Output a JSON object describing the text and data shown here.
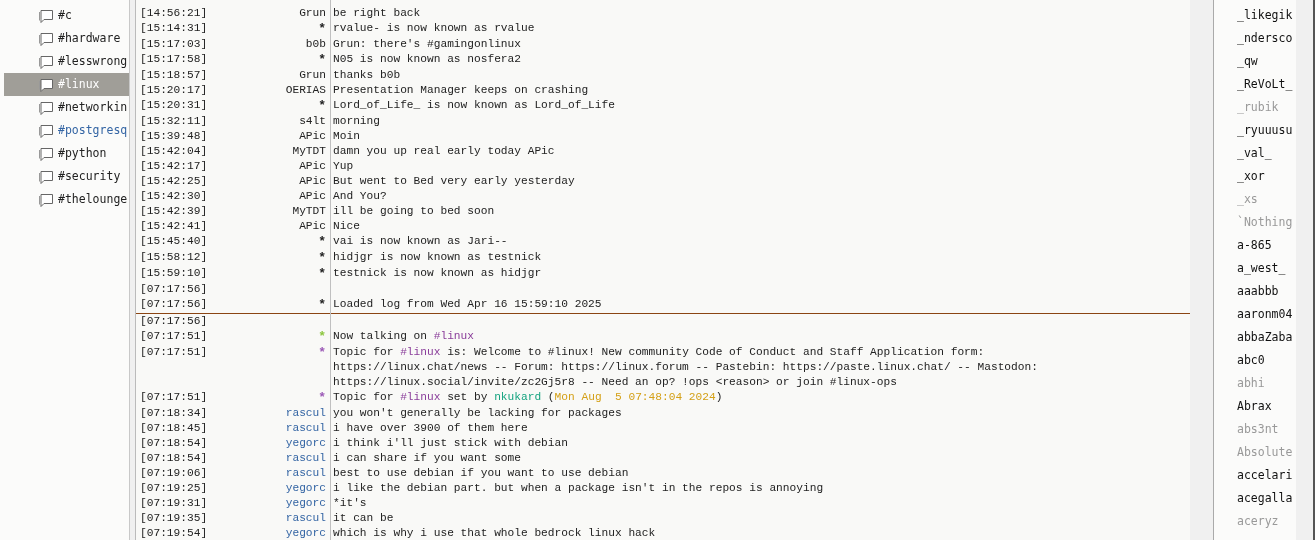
{
  "channels": [
    {
      "name": "#c",
      "selected": false,
      "unread": false
    },
    {
      "name": "#hardware",
      "selected": false,
      "unread": false
    },
    {
      "name": "#lesswrong",
      "selected": false,
      "unread": false
    },
    {
      "name": "#linux",
      "selected": true,
      "unread": false
    },
    {
      "name": "#networkin",
      "selected": false,
      "unread": false
    },
    {
      "name": "#postgresq",
      "selected": false,
      "unread": true
    },
    {
      "name": "#python",
      "selected": false,
      "unread": false
    },
    {
      "name": "#security",
      "selected": false,
      "unread": false
    },
    {
      "name": "#thelounge",
      "selected": false,
      "unread": false
    }
  ],
  "messages": [
    {
      "time": "[14:56:21]",
      "nick": "Grun",
      "parts": [
        {
          "kind": "plain",
          "text": "be right back"
        }
      ]
    },
    {
      "time": "[15:14:31]",
      "nick": "*",
      "parts": [
        {
          "kind": "plain",
          "text": "rvalue- is now known as rvalue"
        }
      ]
    },
    {
      "time": "[15:17:03]",
      "nick": "b0b",
      "parts": [
        {
          "kind": "plain",
          "text": "Grun: there's #gamingonlinux"
        }
      ]
    },
    {
      "time": "[15:17:58]",
      "nick": "*",
      "parts": [
        {
          "kind": "plain",
          "text": "N05 is now known as nosfera2"
        }
      ]
    },
    {
      "time": "[15:18:57]",
      "nick": "Grun",
      "parts": [
        {
          "kind": "plain",
          "text": "thanks b0b"
        }
      ]
    },
    {
      "time": "[15:20:17]",
      "nick": "OERIAS",
      "parts": [
        {
          "kind": "plain",
          "text": "Presentation Manager keeps on crashing"
        }
      ]
    },
    {
      "time": "[15:20:31]",
      "nick": "*",
      "parts": [
        {
          "kind": "plain",
          "text": "Lord_of_Life_ is now known as Lord_of_Life"
        }
      ]
    },
    {
      "time": "[15:32:11]",
      "nick": "s4lt",
      "parts": [
        {
          "kind": "plain",
          "text": "morning"
        }
      ]
    },
    {
      "time": "[15:39:48]",
      "nick": "APic",
      "parts": [
        {
          "kind": "plain",
          "text": "Moin"
        }
      ]
    },
    {
      "time": "[15:42:04]",
      "nick": "MyTDT",
      "parts": [
        {
          "kind": "plain",
          "text": "damn you up real early today APic"
        }
      ]
    },
    {
      "time": "[15:42:17]",
      "nick": "APic",
      "parts": [
        {
          "kind": "plain",
          "text": "Yup"
        }
      ]
    },
    {
      "time": "[15:42:25]",
      "nick": "APic",
      "parts": [
        {
          "kind": "plain",
          "text": "But went to Bed very early yesterday"
        }
      ]
    },
    {
      "time": "[15:42:30]",
      "nick": "APic",
      "parts": [
        {
          "kind": "plain",
          "text": "And You?"
        }
      ]
    },
    {
      "time": "[15:42:39]",
      "nick": "MyTDT",
      "parts": [
        {
          "kind": "plain",
          "text": "ill be going to bed soon"
        }
      ]
    },
    {
      "time": "[15:42:41]",
      "nick": "APic",
      "parts": [
        {
          "kind": "plain",
          "text": "Nice"
        }
      ]
    },
    {
      "time": "[15:45:40]",
      "nick": "*",
      "parts": [
        {
          "kind": "plain",
          "text": "vai is now known as Jari--"
        }
      ]
    },
    {
      "time": "[15:58:12]",
      "nick": "*",
      "parts": [
        {
          "kind": "plain",
          "text": "hidjgr is now known as testnick"
        }
      ]
    },
    {
      "time": "[15:59:10]",
      "nick": "*",
      "parts": [
        {
          "kind": "plain",
          "text": "testnick is now known as hidjgr"
        }
      ]
    },
    {
      "time": "[07:17:56]"
    },
    {
      "time": "[07:17:56]",
      "nick": "*",
      "marker_below": true,
      "parts": [
        {
          "kind": "plain",
          "text": "Loaded log from Wed Apr 16 15:59:10 2025"
        }
      ]
    },
    {
      "time": "[07:17:56]"
    },
    {
      "time": "[07:17:51]",
      "nick": "*",
      "color": "#8cc63f",
      "parts": [
        {
          "kind": "plain",
          "text": "Now talking on "
        },
        {
          "kind": "channel",
          "text": "#linux"
        }
      ]
    },
    {
      "time": "[07:17:51]",
      "nick": "*",
      "color": "#9b59b6",
      "parts": [
        {
          "kind": "plain",
          "text": "Topic for "
        },
        {
          "kind": "channel",
          "text": "#linux"
        },
        {
          "kind": "plain",
          "text": " is: Welcome to #linux! New community Code of Conduct and Staff Application form:\nhttps://linux.chat/news -- Forum: https://linux.forum -- Pastebin: https://paste.linux.chat/ -- Mastodon:\nhttps://linux.social/invite/zc2Gj5r8 -- Need an op? !ops <reason> or join #linux-ops"
        }
      ]
    },
    {
      "time": "[07:17:51]",
      "nick": "*",
      "color": "#9b59b6",
      "parts": [
        {
          "kind": "plain",
          "text": "Topic for "
        },
        {
          "kind": "channel",
          "text": "#linux"
        },
        {
          "kind": "plain",
          "text": " set by "
        },
        {
          "kind": "nick",
          "text": "nkukard"
        },
        {
          "kind": "plain",
          "text": " ("
        },
        {
          "kind": "date",
          "text": "Mon Aug  5 07:48:04 2024"
        },
        {
          "kind": "plain",
          "text": ")"
        }
      ]
    },
    {
      "time": "[07:18:34]",
      "nick": "rascul",
      "color": "#3465a4",
      "parts": [
        {
          "kind": "plain",
          "text": "you won't generally be lacking for packages"
        }
      ]
    },
    {
      "time": "[07:18:45]",
      "nick": "rascul",
      "color": "#3465a4",
      "parts": [
        {
          "kind": "plain",
          "text": "i have over 3900 of them here"
        }
      ]
    },
    {
      "time": "[07:18:54]",
      "nick": "yegorc",
      "color": "#3465a4",
      "parts": [
        {
          "kind": "plain",
          "text": "i think i'll just stick with debian"
        }
      ]
    },
    {
      "time": "[07:18:54]",
      "nick": "rascul",
      "color": "#3465a4",
      "parts": [
        {
          "kind": "plain",
          "text": "i can share if you want some"
        }
      ]
    },
    {
      "time": "[07:19:06]",
      "nick": "rascul",
      "color": "#3465a4",
      "parts": [
        {
          "kind": "plain",
          "text": "best to use debian if you want to use debian"
        }
      ]
    },
    {
      "time": "[07:19:25]",
      "nick": "yegorc",
      "color": "#3465a4",
      "parts": [
        {
          "kind": "plain",
          "text": "i like the debian part. but when a package isn't in the repos is annoying"
        }
      ]
    },
    {
      "time": "[07:19:31]",
      "nick": "yegorc",
      "color": "#3465a4",
      "parts": [
        {
          "kind": "plain",
          "text": "*it's"
        }
      ]
    },
    {
      "time": "[07:19:35]",
      "nick": "rascul",
      "color": "#3465a4",
      "parts": [
        {
          "kind": "plain",
          "text": "it can be"
        }
      ]
    },
    {
      "time": "[07:19:54]",
      "nick": "yegorc",
      "color": "#3465a4",
      "parts": [
        {
          "kind": "plain",
          "text": "which is why i use that whole bedrock linux hack"
        }
      ]
    }
  ],
  "users": [
    {
      "nick": "_likegik",
      "away": false
    },
    {
      "nick": "_ndersco",
      "away": false
    },
    {
      "nick": "_qw",
      "away": false
    },
    {
      "nick": "_ReVoLt_",
      "away": false
    },
    {
      "nick": "_rubik",
      "away": true
    },
    {
      "nick": "_ryuuusu",
      "away": false
    },
    {
      "nick": "_val_",
      "away": false
    },
    {
      "nick": "_xor",
      "away": false
    },
    {
      "nick": "_xs",
      "away": true
    },
    {
      "nick": "`Nothing",
      "away": true
    },
    {
      "nick": "a-865",
      "away": false
    },
    {
      "nick": "a_west_",
      "away": false
    },
    {
      "nick": "aaabbb",
      "away": false
    },
    {
      "nick": "aaronm04",
      "away": false
    },
    {
      "nick": "abbaZaba",
      "away": false
    },
    {
      "nick": "abc0",
      "away": false
    },
    {
      "nick": "abhi",
      "away": true
    },
    {
      "nick": "Abrax",
      "away": false
    },
    {
      "nick": "abs3nt",
      "away": true
    },
    {
      "nick": "Absolute",
      "away": true
    },
    {
      "nick": "accelari",
      "away": false
    },
    {
      "nick": "acegalla",
      "away": false
    },
    {
      "nick": "aceryz",
      "away": true
    }
  ]
}
